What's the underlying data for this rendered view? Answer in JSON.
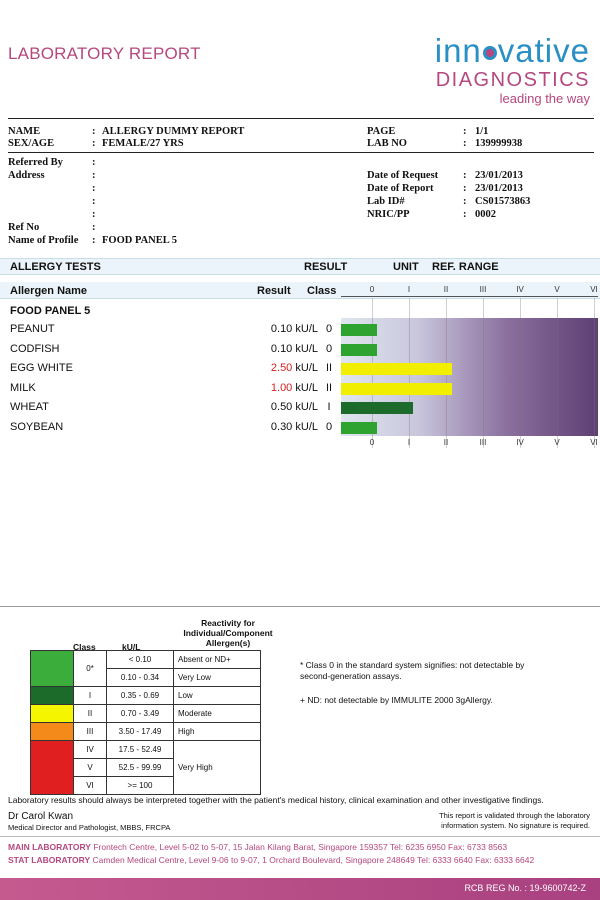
{
  "header": {
    "title": "LABORATORY REPORT",
    "logo_word1_a": "inn",
    "logo_word1_b": "vative",
    "logo_word2": "DIAGNOSTICS",
    "logo_tagline": "leading the way"
  },
  "patient": {
    "name_label": "NAME",
    "name_value": "ALLERGY DUMMY REPORT",
    "sexage_label": "SEX/AGE",
    "sexage_value": "FEMALE/27 YRS",
    "page_label": "PAGE",
    "page_value": "1/1",
    "labno_label": "LAB NO",
    "labno_value": "139999938",
    "referred_label": "Referred By",
    "address_label": "Address",
    "date_request_label": "Date of Request",
    "date_request_value": "23/01/2013",
    "date_report_label": "Date of Report",
    "date_report_value": "23/01/2013",
    "labid_label": "Lab ID#",
    "labid_value": "CS01573863",
    "nric_label": "NRIC/PP",
    "nric_value": "0002",
    "refno_label": "Ref No",
    "profile_label": "Name of Profile",
    "profile_value": "FOOD PANEL 5",
    "colon": ":"
  },
  "tests_header": {
    "title": "ALLERGY TESTS",
    "result": "RESULT",
    "unit": "UNIT",
    "ref_range": "REF. RANGE"
  },
  "columns": {
    "allergen": "Allergen Name",
    "result": "Result",
    "class": "Class",
    "scale": [
      "0",
      "I",
      "II",
      "III",
      "IV",
      "V",
      "VI"
    ]
  },
  "panel_title": "FOOD PANEL 5",
  "allergens": [
    {
      "name": "PEANUT",
      "result": "0.10 kU/L",
      "class": "0",
      "highlight": false,
      "bar_color": "#2fa32f",
      "bar_fraction": 0.14
    },
    {
      "name": "CODFISH",
      "result": "0.10 kU/L",
      "class": "0",
      "highlight": false,
      "bar_color": "#2fa32f",
      "bar_fraction": 0.14
    },
    {
      "name": "EGG WHITE",
      "result": "2.50 kU/L",
      "class": "II",
      "highlight": true,
      "bar_color": "#f2ee00",
      "bar_fraction": 0.43
    },
    {
      "name": "MILK",
      "result": "1.00 kU/L",
      "class": "II",
      "highlight": true,
      "bar_color": "#f2ee00",
      "bar_fraction": 0.43
    },
    {
      "name": "WHEAT",
      "result": "0.50 kU/L",
      "class": "I",
      "highlight": false,
      "bar_color": "#1d6b2a",
      "bar_fraction": 0.28
    },
    {
      "name": "SOYBEAN",
      "result": "0.30 kU/L",
      "class": "0",
      "highlight": false,
      "bar_color": "#2fa32f",
      "bar_fraction": 0.14
    }
  ],
  "legend": {
    "col_class": "Class",
    "col_ku": "kU/L",
    "col_reactivity": "Reactivity for Individual/Component Allergen(s)",
    "rows": [
      {
        "color": "#3aad3a",
        "class": "0*",
        "range": "< 0.10",
        "reactivity": "Absent or ND+"
      },
      {
        "color": "#3aad3a",
        "class": "",
        "range": "0.10 - 0.34",
        "reactivity": "Very Low"
      },
      {
        "color": "#1d6b2a",
        "class": "I",
        "range": "0.35 - 0.69",
        "reactivity": "Low"
      },
      {
        "color": "#f5f500",
        "class": "II",
        "range": "0.70 - 3.49",
        "reactivity": "Moderate"
      },
      {
        "color": "#f38a1a",
        "class": "III",
        "range": "3.50 - 17.49",
        "reactivity": "High"
      },
      {
        "color": "#e02020",
        "class": "IV",
        "range": "17.5 - 52.49",
        "reactivity": ""
      },
      {
        "color": "#e02020",
        "class": "V",
        "range": "52.5 - 99.99",
        "reactivity": "Very High"
      },
      {
        "color": "#e02020",
        "class": "VI",
        "range": ">= 100",
        "reactivity": ""
      }
    ],
    "note1": "* Class 0 in the standard system signifies: not detectable by second-generation assays.",
    "note2": "+ ND: not detectable by IMMULITE 2000 3gAllergy."
  },
  "disclaimer": "Laboratory results should always be interpreted together with the patient's medical history, clinical examination and other investigative findings.",
  "doctor": {
    "name": "Dr Carol Kwan",
    "title": "Medical Director and Pathologist, MBBS, FRCPA"
  },
  "validation": "This report is validated through the laboratory information system. No signature is required.",
  "labs": {
    "main_label": "MAIN LABORATORY",
    "main_text": "Frontech Centre, Level 5-02 to 5-07, 15 Jalan Kilang Barat, Singapore 159357 Tel: 6235 6950 Fax: 6733 8563",
    "stat_label": "STAT LABORATORY",
    "stat_text": "Camden Medical Centre, Level 9-06 to 9-07, 1 Orchard Boulevard, Singapore 248649 Tel: 6333 6640 Fax: 6333 6642"
  },
  "rcb": "RCB REG No. : 19-9600742-Z"
}
